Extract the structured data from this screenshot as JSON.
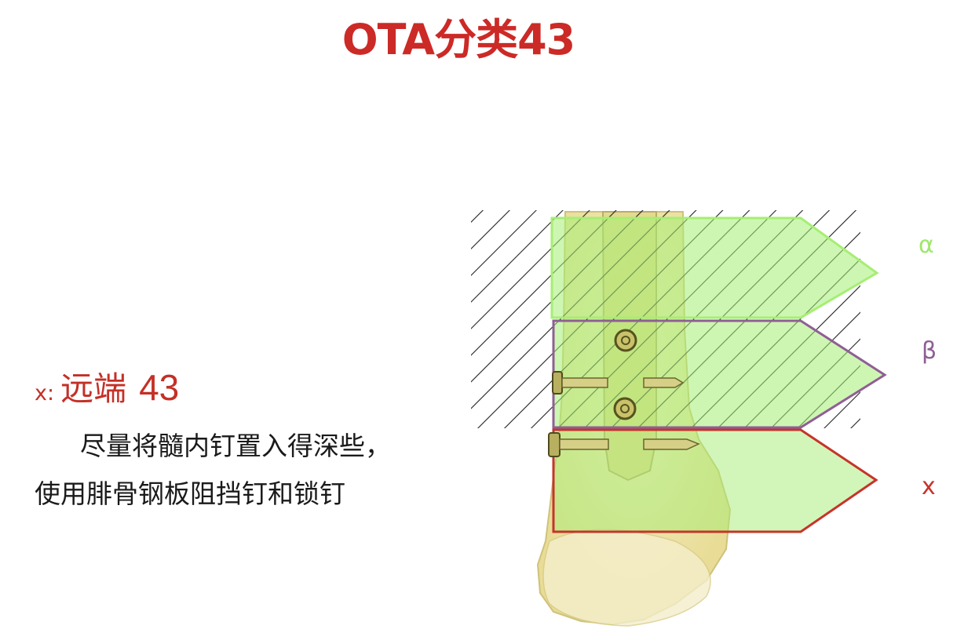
{
  "title": "OTA分类43",
  "section": {
    "prefix": "x:",
    "name": "远端",
    "number": "43"
  },
  "body": {
    "line1": "尽量将髓内钉置入得深些，",
    "line2": "使用腓骨钢板阻挡钉和锁钉"
  },
  "zones": {
    "alpha": {
      "label": "α",
      "color": "#a6ee74"
    },
    "beta": {
      "label": "β",
      "color": "#8f5f95"
    },
    "x": {
      "label": "x",
      "color": "#c6342b"
    }
  },
  "colors": {
    "title": "#cc2a26",
    "heading": "#c43027",
    "bone": "#f0e8ae",
    "hatch": "#222222"
  }
}
